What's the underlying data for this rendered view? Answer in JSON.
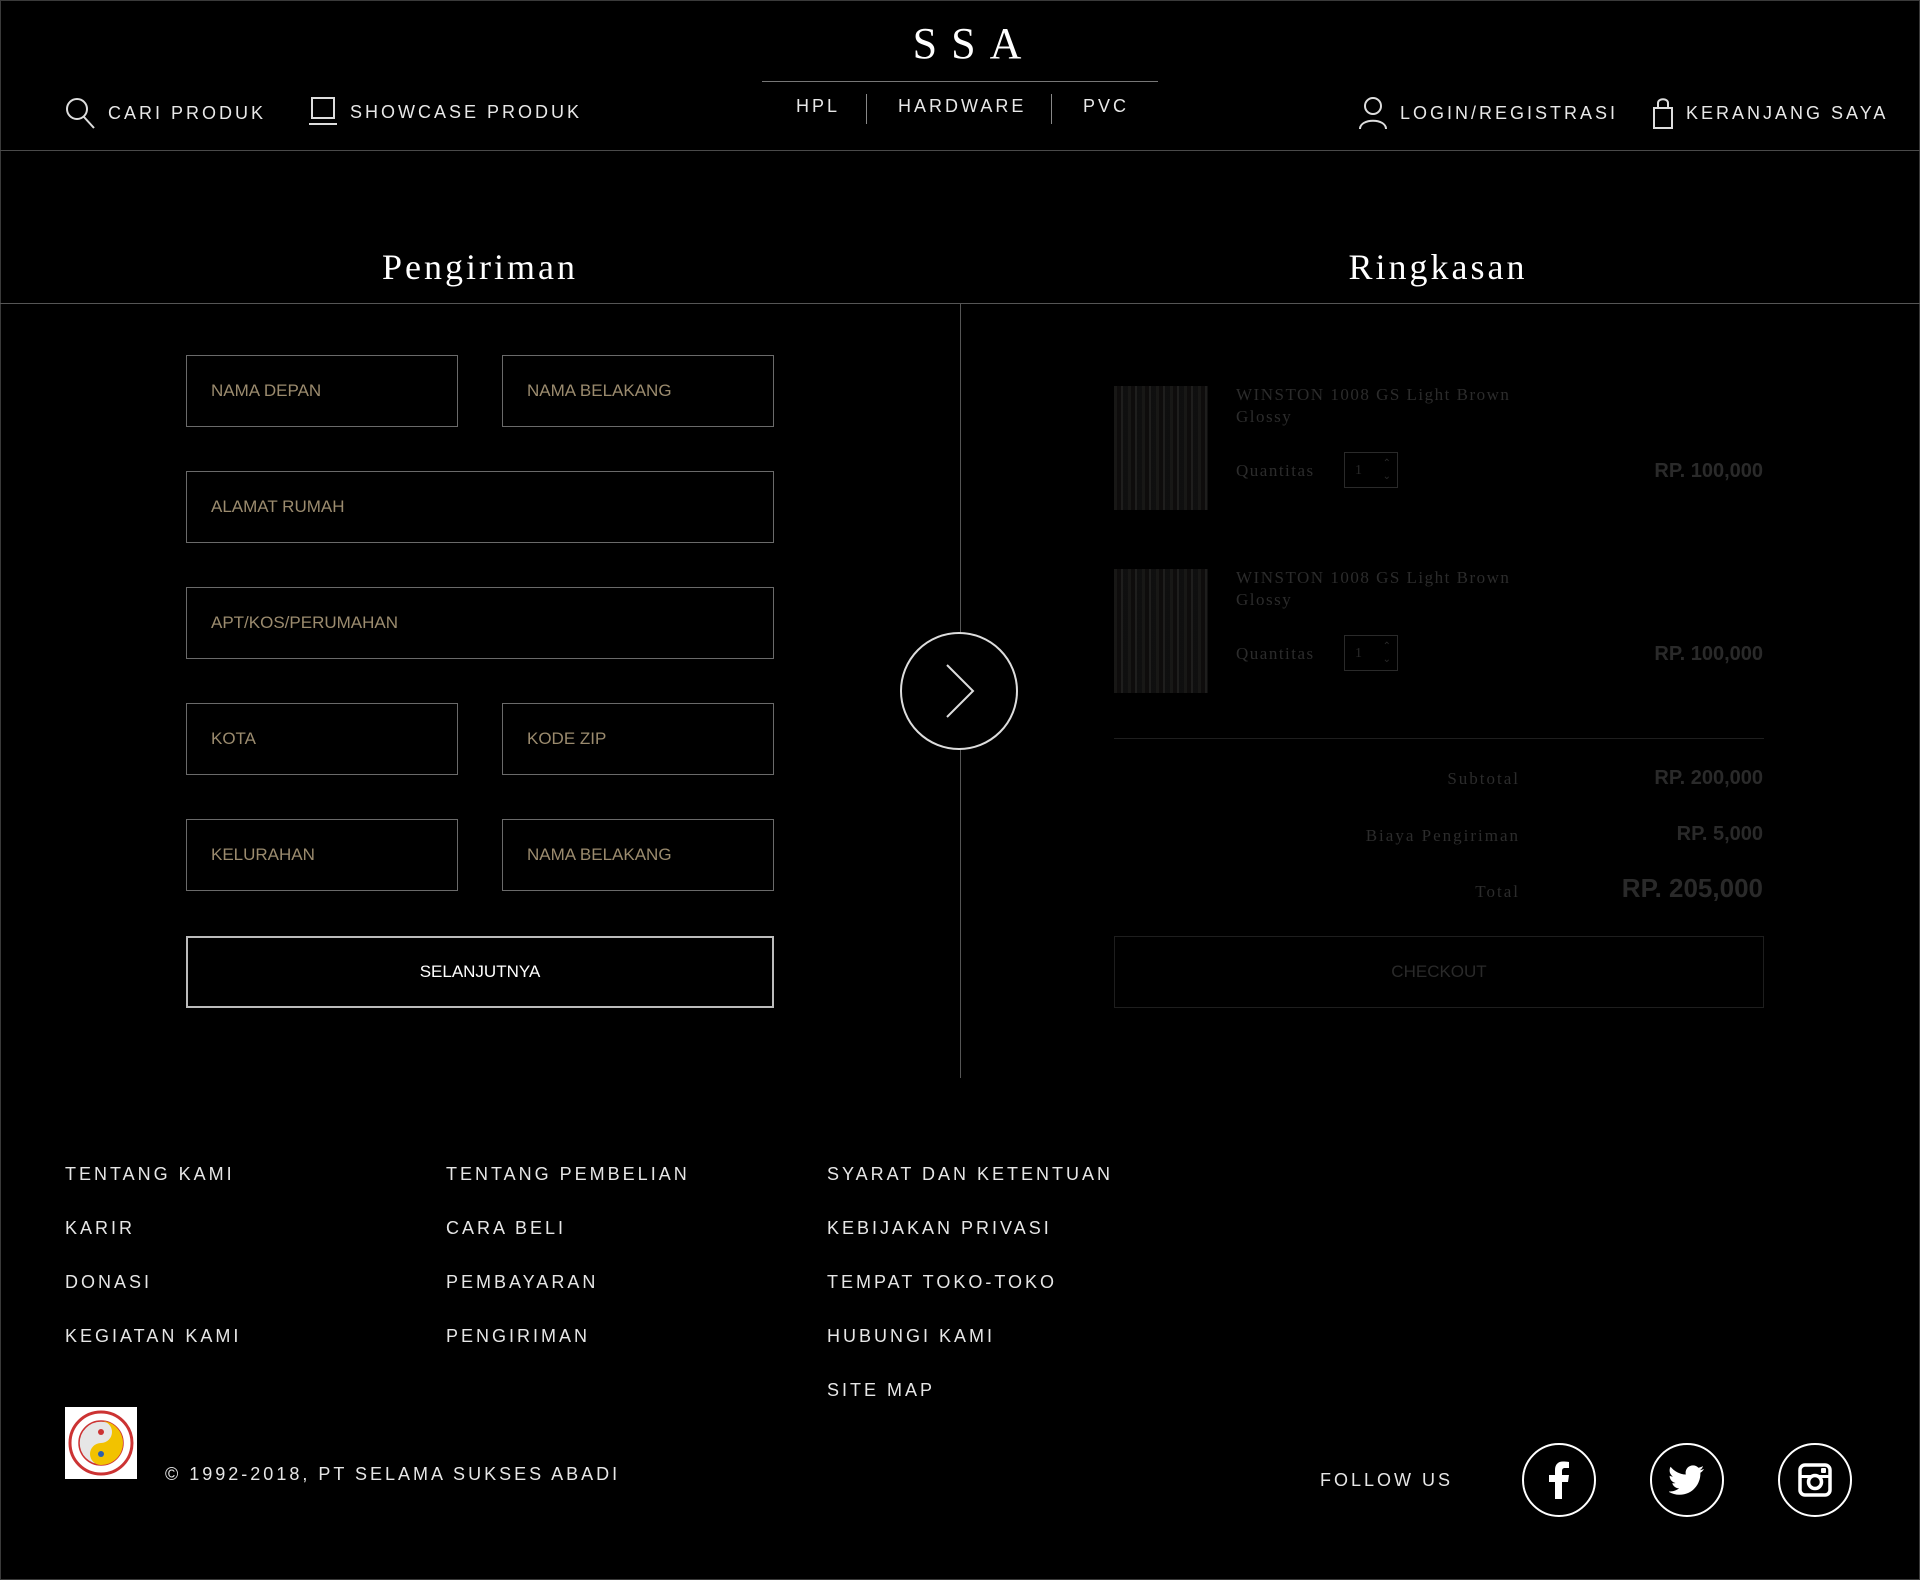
{
  "header": {
    "logo": "SSA",
    "search_label": "CARI PRODUK",
    "showcase_label": "SHOWCASE PRODUK",
    "categories": [
      "HPL",
      "HARDWARE",
      "PVC"
    ],
    "login_label": "LOGIN/REGISTRASI",
    "cart_label": "KERANJANG SAYA"
  },
  "shipping": {
    "title": "Pengiriman",
    "fields": {
      "first_name": "NAMA DEPAN",
      "last_name": "NAMA BELAKANG",
      "address": "ALAMAT RUMAH",
      "apt": "APT/KOS/PERUMAHAN",
      "city": "KOTA",
      "zip": "KODE ZIP",
      "district": "KELURAHAN",
      "last_name_2": "NAMA BELAKANG"
    },
    "next_label": "SELANJUTNYA"
  },
  "summary": {
    "title": "Ringkasan",
    "items": [
      {
        "name": "WINSTON 1008 GS Light Brown Glossy",
        "qty_label": "Quantitas",
        "qty": "1",
        "price": "RP. 100,000"
      },
      {
        "name": "WINSTON 1008 GS Light Brown Glossy",
        "qty_label": "Quantitas",
        "qty": "1",
        "price": "RP. 100,000"
      }
    ],
    "subtotal_label": "Subtotal",
    "subtotal": "RP. 200,000",
    "shipping_label": "Biaya Pengiriman",
    "shipping_cost": "RP. 5,000",
    "total_label": "Total",
    "total": "RP. 205,000",
    "checkout_label": "CHECKOUT"
  },
  "footer": {
    "col1": [
      "TENTANG KAMI",
      "KARIR",
      "DONASI",
      "KEGIATAN KAMI"
    ],
    "col2": [
      "TENTANG PEMBELIAN",
      "CARA BELI",
      "PEMBAYARAN",
      "PENGIRIMAN"
    ],
    "col3": [
      "SYARAT DAN KETENTUAN",
      "KEBIJAKAN PRIVASI",
      "TEMPAT TOKO-TOKO",
      "HUBUNGI KAMI",
      "SITE MAP"
    ],
    "copyright": "© 1992-2018, PT SELAMA SUKSES ABADI",
    "follow_label": "FOLLOW US",
    "social": [
      "facebook-icon",
      "twitter-icon",
      "instagram-icon"
    ]
  },
  "colors": {
    "background": "#000000",
    "text": "#ffffff",
    "placeholder": "#9b8b6e",
    "faded": "#2a2a2a"
  }
}
